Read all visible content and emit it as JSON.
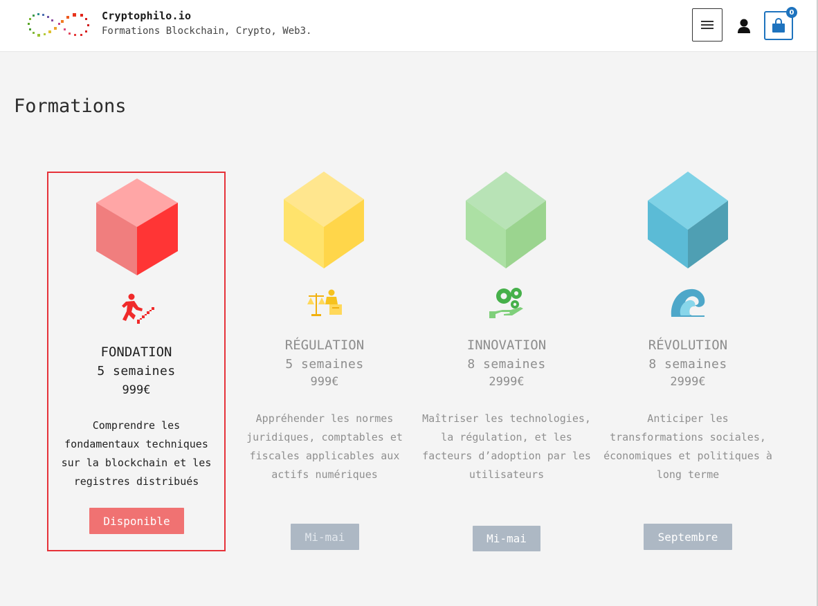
{
  "header": {
    "site_title": "Cryptophilo.io",
    "tagline": "Formations Blockchain, Crypto, Web3.",
    "cart_count": "0"
  },
  "page": {
    "title": "Formations"
  },
  "cards": [
    {
      "name": "FONDATION",
      "duration": "5 semaines",
      "price": "999€",
      "description": "Comprendre les fondamentaux techniques sur la blockchain et les registres distribués",
      "button": "Disponible",
      "color": "#ff3b3b"
    },
    {
      "name": "RÉGULATION",
      "duration": "5 semaines",
      "price": "999€",
      "description": "Appréhender les normes juridiques, comptables et fiscales applicables aux actifs numériques",
      "button": "Mi-mai",
      "color": "#ffd84d"
    },
    {
      "name": "INNOVATION",
      "duration": "8 semaines",
      "price": "2999€",
      "description": "Maîtriser les technologies, la régulation, et les facteurs d’adoption par les utilisateurs",
      "button": "Mi-mai",
      "color": "#9bd48f"
    },
    {
      "name": "RÉVOLUTION",
      "duration": "8 semaines",
      "price": "2999€",
      "description": "Anticiper les transformations sociales, économiques et politiques à long terme",
      "button": "Septembre",
      "color": "#57b6d3"
    }
  ],
  "icons": {
    "logo": "infinity-dots-logo",
    "menu": "hamburger-icon",
    "account": "user-icon",
    "cart": "shopping-bag-icon",
    "fondation": "stairs-runner-icon",
    "regulation": "scales-justice-icon",
    "innovation": "gears-hand-icon",
    "revolution": "wave-icon"
  }
}
